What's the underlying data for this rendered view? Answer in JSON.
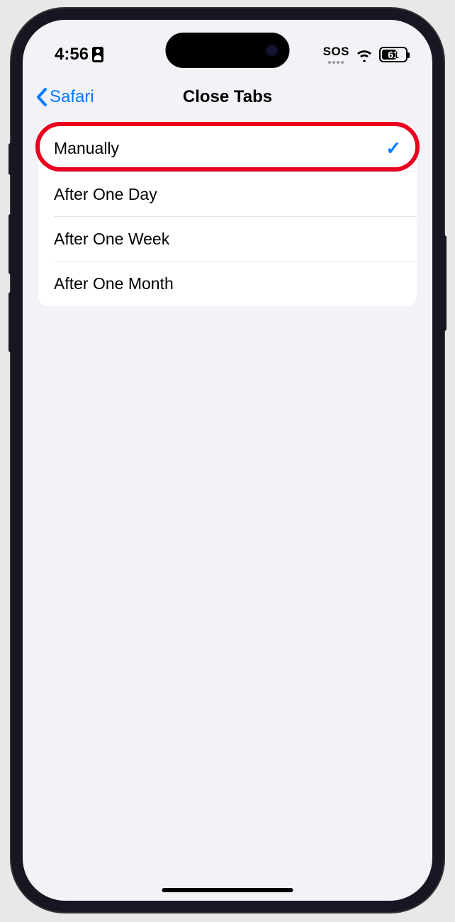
{
  "status": {
    "time": "4:56",
    "sos": "SOS",
    "battery_percent": "61"
  },
  "nav": {
    "back_label": "Safari",
    "title": "Close Tabs"
  },
  "options": [
    {
      "label": "Manually",
      "selected": true,
      "highlighted": true
    },
    {
      "label": "After One Day",
      "selected": false,
      "highlighted": false
    },
    {
      "label": "After One Week",
      "selected": false,
      "highlighted": false
    },
    {
      "label": "After One Month",
      "selected": false,
      "highlighted": false
    }
  ]
}
